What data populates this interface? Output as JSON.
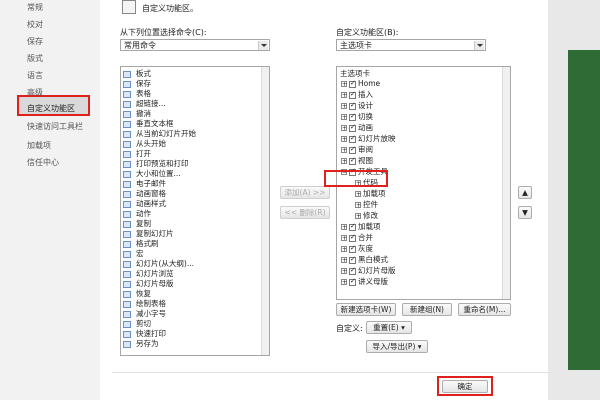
{
  "nav": {
    "items": [
      "常规",
      "校对",
      "保存",
      "版式",
      "语言",
      "高级",
      "自定义功能区",
      "快速访问工具栏",
      "加载项",
      "信任中心"
    ],
    "selected_index": 6
  },
  "header": {
    "title": "自定义功能区。"
  },
  "left": {
    "label": "从下列位置选择命令(C):",
    "dropdown_value": "常用命令",
    "commands": [
      "板式",
      "保存",
      "表格",
      "超链接...",
      "撤消",
      "垂直文本框",
      "从当前幻灯片开始",
      "从头开始",
      "打开",
      "打印预览和打印",
      "大小和位置...",
      "电子邮件",
      "动画窗格",
      "动画样式",
      "动作",
      "复制",
      "复制幻灯片",
      "格式刷",
      "宏",
      "幻灯片(从大纲)...",
      "幻灯片浏览",
      "幻灯片母版",
      "恢复",
      "绘制表格",
      "减小字号",
      "剪切",
      "快速打印",
      "另存为"
    ]
  },
  "middle": {
    "add_label": "添加(A) >>",
    "remove_label": "<< 删除(R)"
  },
  "right": {
    "label": "自定义功能区(B):",
    "dropdown_value": "主选项卡",
    "tree_header": "主选项卡",
    "tree": [
      {
        "label": "Home",
        "checked": true,
        "expanded": false,
        "level": 0
      },
      {
        "label": "插入",
        "checked": true,
        "expanded": false,
        "level": 0
      },
      {
        "label": "设计",
        "checked": true,
        "expanded": false,
        "level": 0
      },
      {
        "label": "切换",
        "checked": true,
        "expanded": false,
        "level": 0
      },
      {
        "label": "动画",
        "checked": true,
        "expanded": false,
        "level": 0
      },
      {
        "label": "幻灯片放映",
        "checked": true,
        "expanded": false,
        "level": 0
      },
      {
        "label": "审阅",
        "checked": true,
        "expanded": false,
        "level": 0
      },
      {
        "label": "视图",
        "checked": true,
        "expanded": false,
        "level": 0
      },
      {
        "label": "开发工具",
        "checked": true,
        "expanded": true,
        "level": 0
      },
      {
        "label": "代码",
        "checked": null,
        "expanded": false,
        "level": 1
      },
      {
        "label": "加载项",
        "checked": null,
        "expanded": false,
        "level": 1
      },
      {
        "label": "控件",
        "checked": null,
        "expanded": false,
        "level": 1
      },
      {
        "label": "修改",
        "checked": null,
        "expanded": false,
        "level": 1
      },
      {
        "label": "加载项",
        "checked": true,
        "expanded": false,
        "level": 0
      },
      {
        "label": "合并",
        "checked": true,
        "expanded": false,
        "level": 0
      },
      {
        "label": "灰度",
        "checked": true,
        "expanded": false,
        "level": 0
      },
      {
        "label": "黑白模式",
        "checked": true,
        "expanded": false,
        "level": 0
      },
      {
        "label": "幻灯片母版",
        "checked": true,
        "expanded": false,
        "level": 0
      },
      {
        "label": "讲义母版",
        "checked": true,
        "expanded": false,
        "level": 0
      }
    ],
    "new_tab_label": "新建选项卡(W)",
    "new_group_label": "新建组(N)",
    "rename_label": "重命名(M)...",
    "custom_label": "自定义:",
    "reset_label": "重置(E) ▾",
    "import_export_label": "导入/导出(P) ▾"
  },
  "footer": {
    "ok_label": "确定"
  },
  "colors": {
    "highlight": "#e0201c",
    "accent_green": "#2f6b35"
  }
}
